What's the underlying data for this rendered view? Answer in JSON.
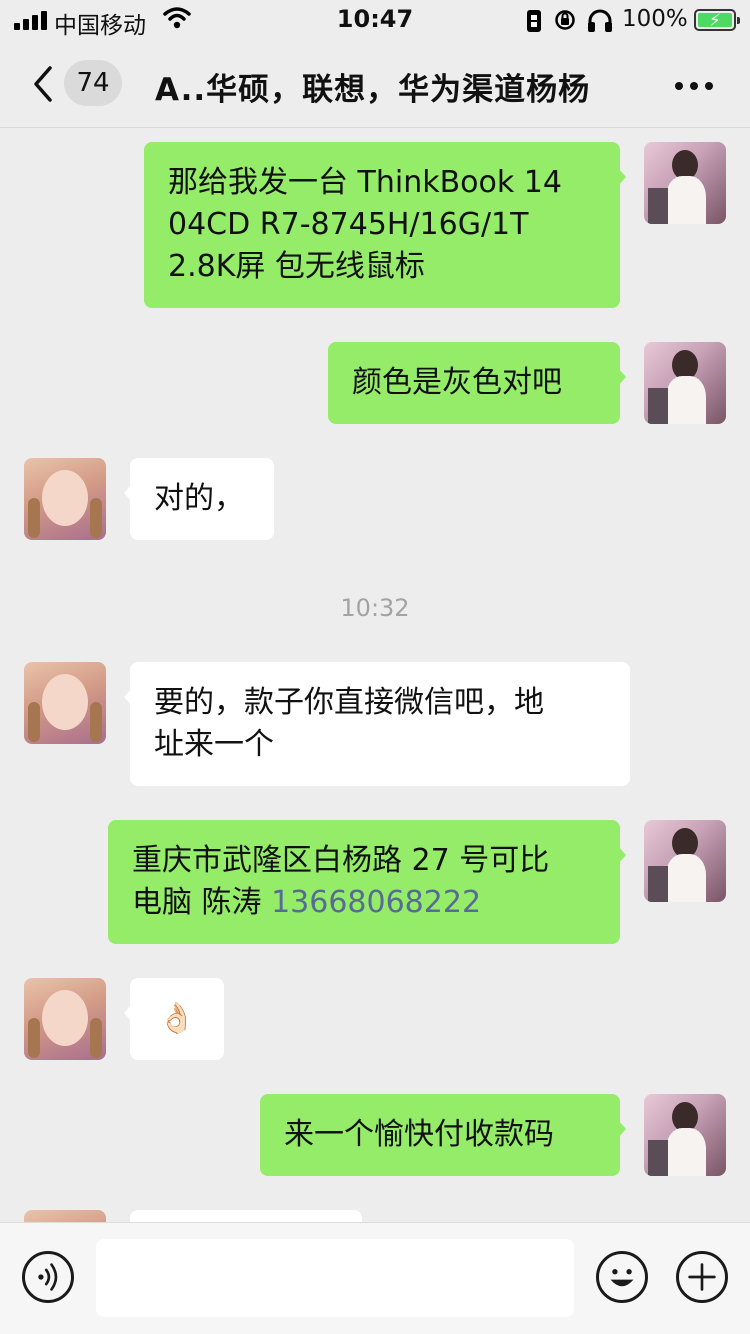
{
  "status_bar": {
    "carrier": "中国移动",
    "time": "10:47",
    "battery_percent": "100%"
  },
  "nav": {
    "unread_count": "74",
    "title": "A..华硕，联想，华为渠道杨杨",
    "icons": {
      "back": "chevron-left-icon",
      "more": "more-icon"
    }
  },
  "messages": [
    {
      "side": "right",
      "lines": [
        "那给我发一台 ThinkBook 14",
        "04CD R7-8745H/16G/1T",
        "2.8K屏  包无线鼠标"
      ]
    },
    {
      "side": "right",
      "lines": [
        "颜色是灰色对吧"
      ]
    },
    {
      "side": "left",
      "lines": [
        "对的，"
      ]
    },
    {
      "side": "left",
      "lines": [
        "要的，款子你直接微信吧，地",
        "址来一个"
      ]
    },
    {
      "side": "right",
      "lines": [
        "重庆市武隆区白杨路 27 号可比",
        "电脑 陈涛 "
      ],
      "phone": "13668068222"
    },
    {
      "side": "left",
      "lines": [
        "👌🏻"
      ]
    },
    {
      "side": "right",
      "lines": [
        "来一个愉快付收款码"
      ]
    }
  ],
  "timestamp": "10:32",
  "input_bar": {
    "icons": {
      "voice": "voice-icon",
      "emoji": "emoji-icon",
      "add": "plus-icon"
    }
  },
  "colors": {
    "background": "#ededed",
    "bubble_sent": "#95ec69",
    "bubble_received": "#ffffff",
    "link": "#576b95"
  }
}
